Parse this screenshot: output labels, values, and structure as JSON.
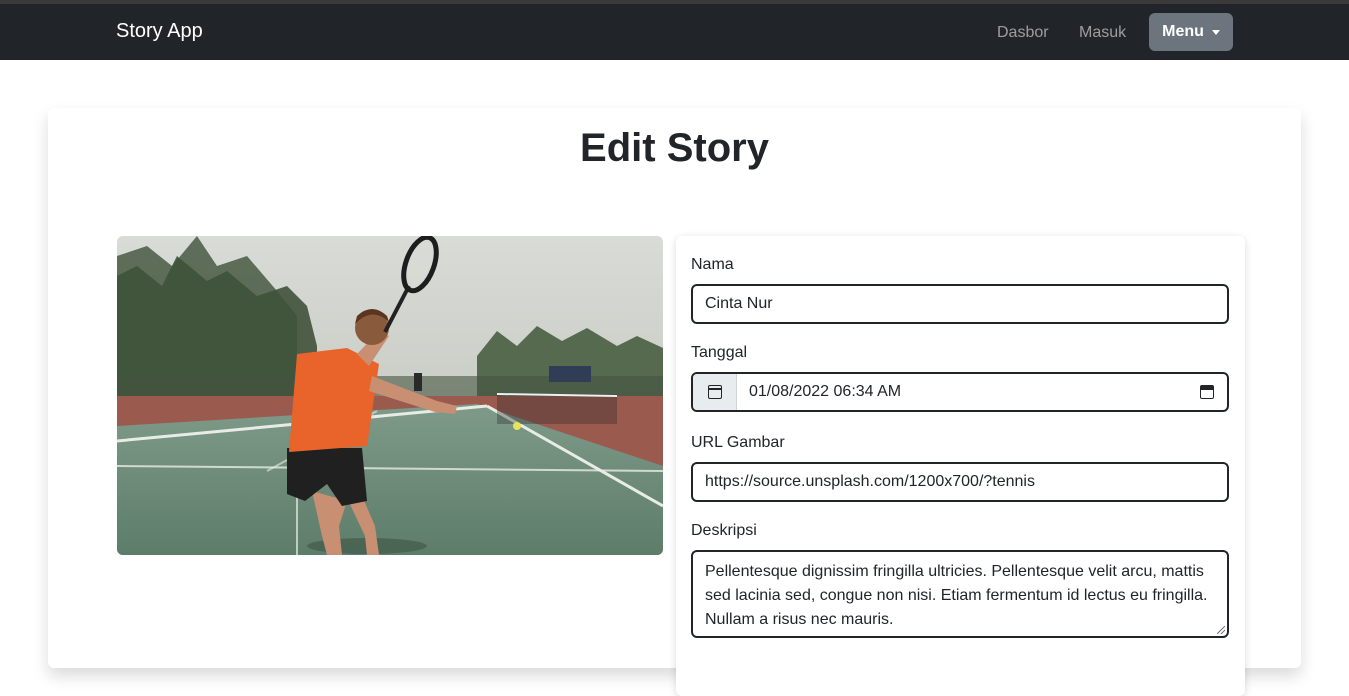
{
  "navbar": {
    "brand": "Story App",
    "links": [
      "Dasbor",
      "Masuk"
    ],
    "menu_label": "Menu"
  },
  "page": {
    "title": "Edit Story"
  },
  "form": {
    "nama_label": "Nama",
    "nama_value": "Cinta Nur",
    "tanggal_label": "Tanggal",
    "tanggal_value": "01/08/2022 06:34  AM",
    "url_label": "URL Gambar",
    "url_value": "https://source.unsplash.com/1200x700/?tennis",
    "deskripsi_label": "Deskripsi",
    "deskripsi_value": "Pellentesque dignissim fringilla ultricies. Pellentesque velit arcu, mattis sed lacinia sed, congue non nisi. Etiam fermentum id lectus eu fringilla. Nullam a risus nec mauris."
  },
  "icons": {
    "date_addon": "calendar-icon",
    "date_picker": "calendar-picker-icon",
    "menu_caret": "caret-down-icon"
  },
  "colors": {
    "navbar_bg": "#212529",
    "menu_button_bg": "#6c757d",
    "field_border": "#212529"
  }
}
